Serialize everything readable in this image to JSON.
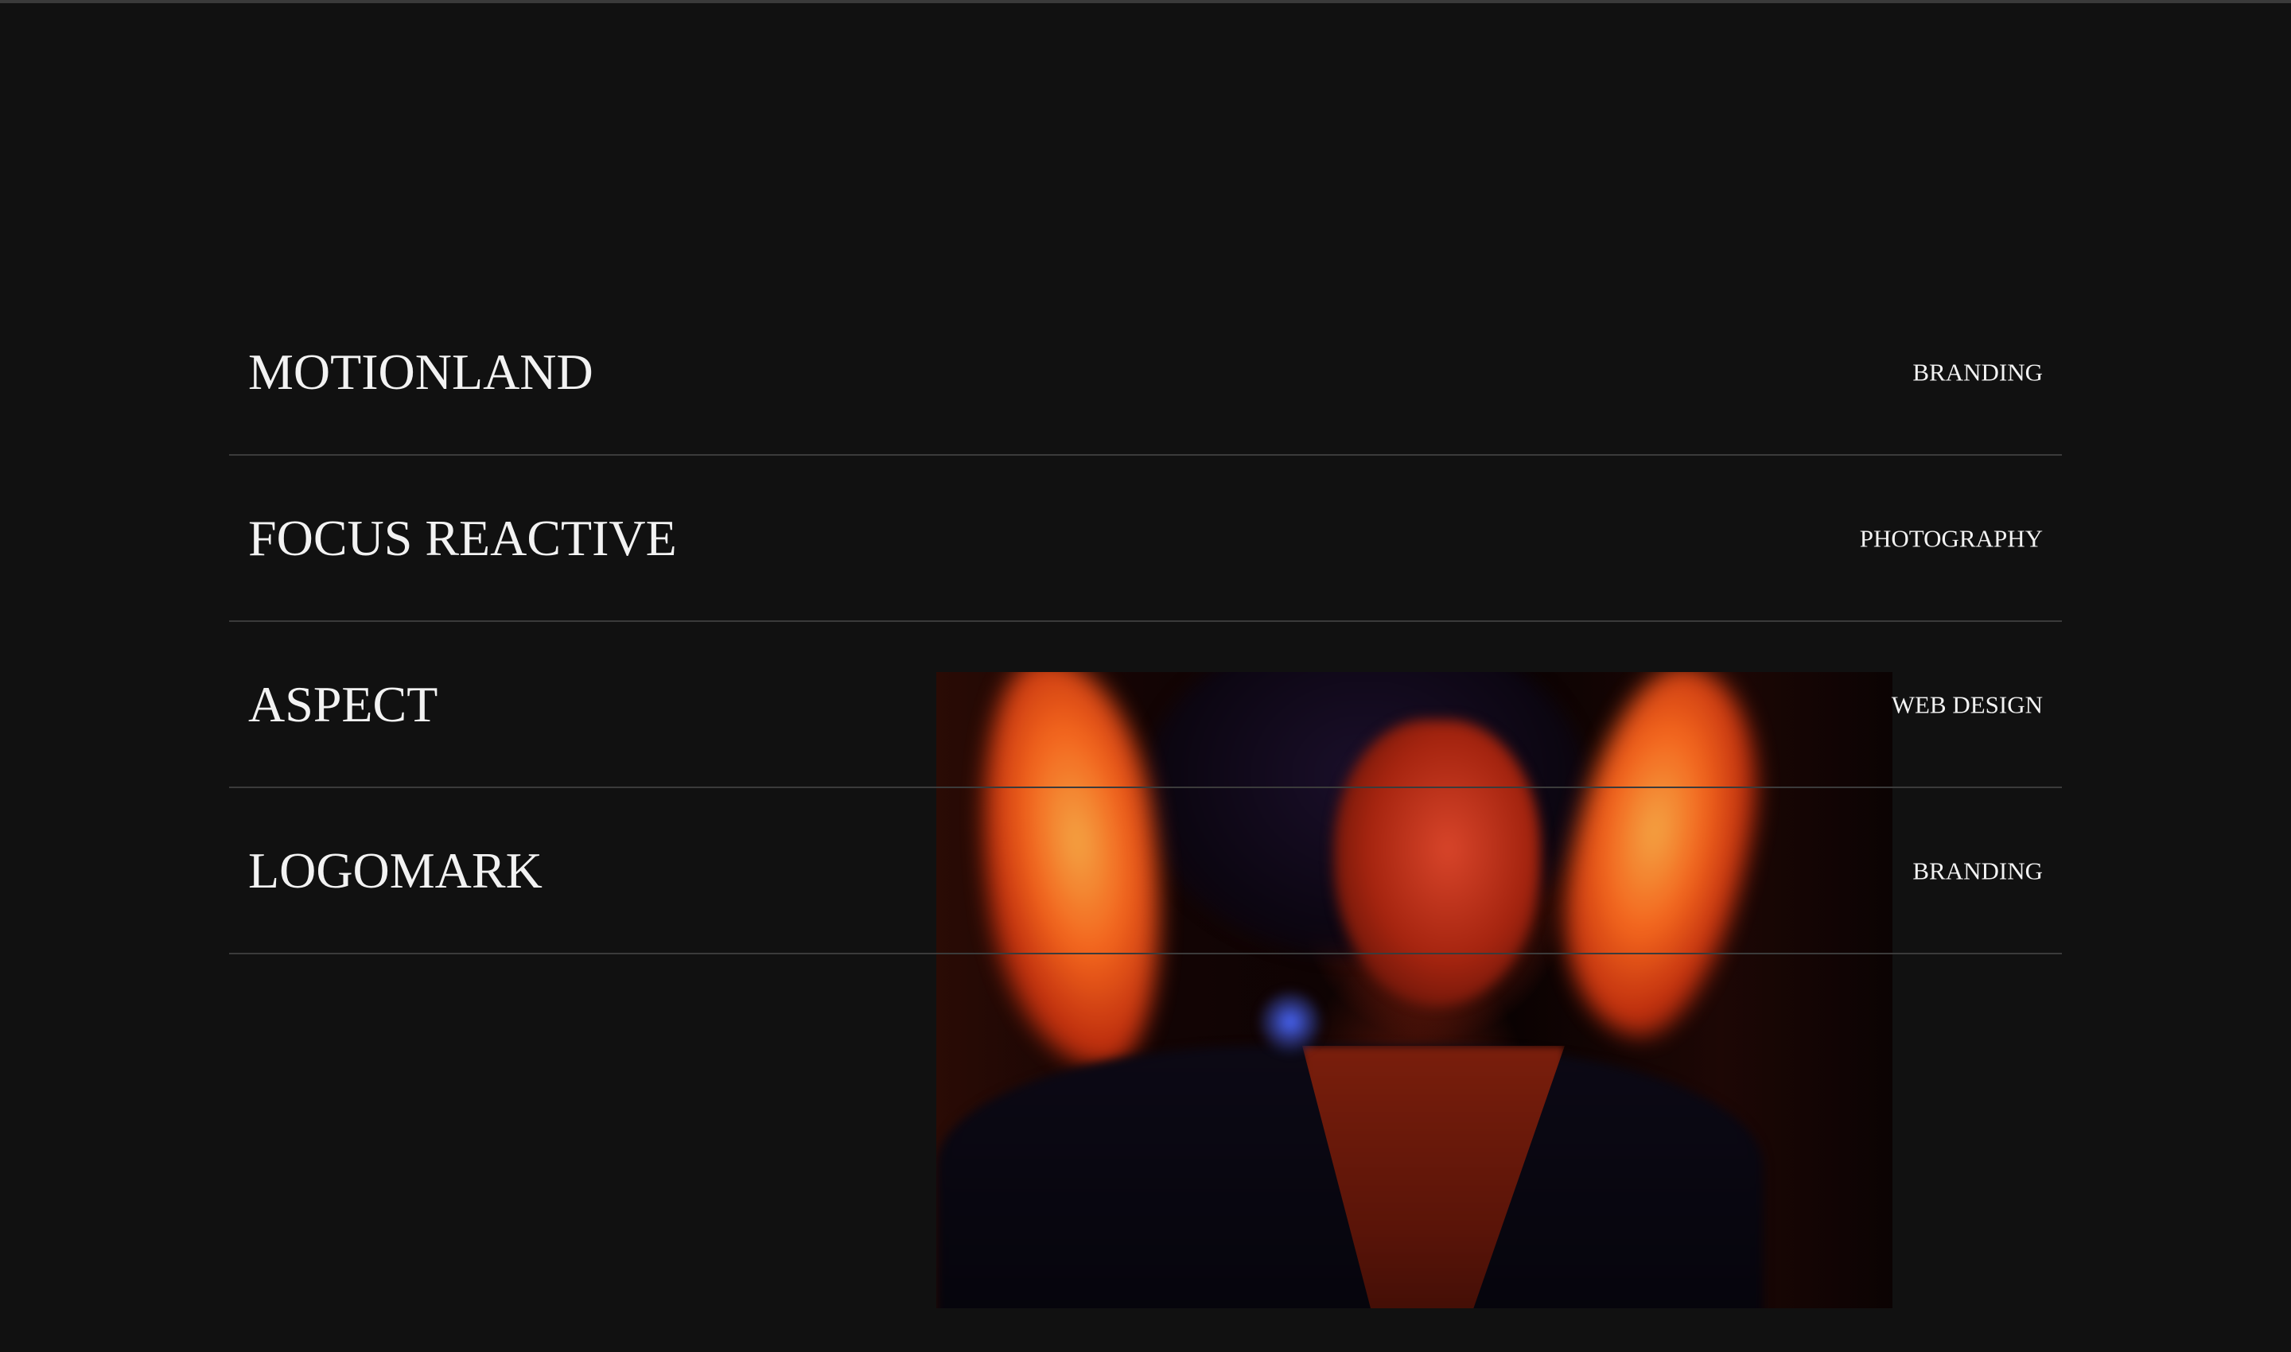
{
  "projects": [
    {
      "title": "MOTIONLAND",
      "category": "BRANDING"
    },
    {
      "title": "FOCUS REACTIVE",
      "category": "PHOTOGRAPHY"
    },
    {
      "title": "ASPECT",
      "category": "WEB DESIGN"
    },
    {
      "title": "LOGOMARK",
      "category": "BRANDING"
    }
  ],
  "colors": {
    "background": "#111111",
    "text": "#f2f2f2",
    "divider": "#3b3b3b"
  }
}
